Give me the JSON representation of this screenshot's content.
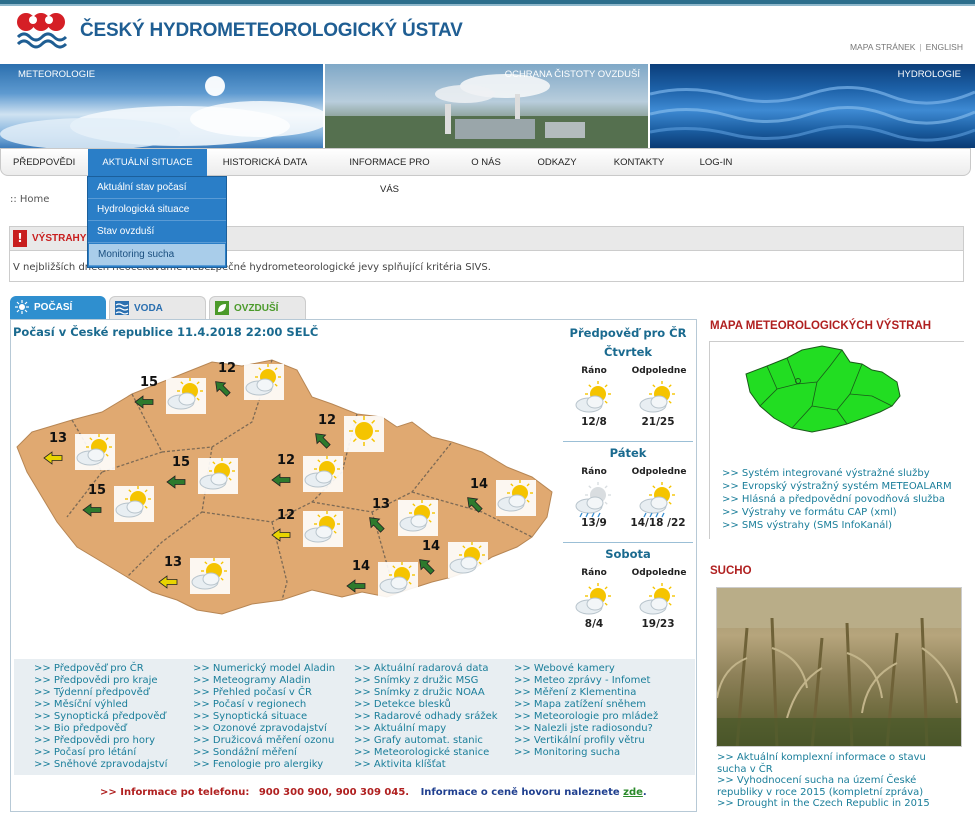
{
  "header": {
    "title": "ČESKÝ HYDROMETEOROLOGICKÝ ÚSTAV",
    "sitemap_link": "MAPA STRÁNEK",
    "separator": "|",
    "english_link": "ENGLISH"
  },
  "banner": {
    "meteo": "METEOROLOGIE",
    "air": "OCHRANA ČISTOTY OVZDUŠÍ",
    "hydro": "HYDROLOGIE"
  },
  "nav": {
    "items": [
      "PŘEDPOVĚDI",
      "AKTUÁLNÍ SITUACE",
      "HISTORICKÁ DATA",
      "INFORMACE PRO VÁS",
      "O NÁS",
      "ODKAZY",
      "KONTAKTY",
      "LOG-IN"
    ],
    "active": "AKTUÁLNÍ SITUACE",
    "dropdown": [
      "Aktuální stav počasí",
      "Hydrologická situace",
      "Stav ovzduší",
      "Monitoring sucha"
    ],
    "dropdown_highlighted": "Monitoring sucha"
  },
  "breadcrumb": ":: Home",
  "warnings": {
    "icon": "!",
    "title": "VÝSTRAHY",
    "text": "V nejbližších dnech neočekáváme nebezpečné hydrometeorologické jevy splňující kritéria SIVS."
  },
  "tabs": [
    {
      "label": "POČASÍ",
      "icon": "sun-icon",
      "active": true
    },
    {
      "label": "VODA",
      "icon": "water-waves-icon",
      "active": false
    },
    {
      "label": "OVZDUŠÍ",
      "icon": "leaf-icon",
      "active": false
    }
  ],
  "weather": {
    "title": "Počasí v České republice 11.4.2018 22:00 SELČ",
    "map_stations": [
      {
        "temp": "15",
        "wind": "W",
        "wind_color": "#2d7a2d",
        "icon": "sun-cloud-icon"
      },
      {
        "temp": "12",
        "wind": "NW",
        "wind_color": "#2d7a2d",
        "icon": "sun-cloud-icon"
      },
      {
        "temp": "12",
        "wind": "NW",
        "wind_color": "#2d7a2d",
        "icon": "sun-icon"
      },
      {
        "temp": "13",
        "wind": "W",
        "wind_color": "#e8d400",
        "icon": "sun-cloud-icon"
      },
      {
        "temp": "15",
        "wind": "W",
        "wind_color": "#2d7a2d",
        "icon": "sun-cloud-icon"
      },
      {
        "temp": "12",
        "wind": "W",
        "wind_color": "#2d7a2d",
        "icon": "sun-cloud-icon"
      },
      {
        "temp": "15",
        "wind": "W",
        "wind_color": "#2d7a2d",
        "icon": "sun-cloud-icon"
      },
      {
        "temp": "14",
        "wind": "NW",
        "wind_color": "#2d7a2d",
        "icon": "sun-cloud-icon"
      },
      {
        "temp": "13",
        "wind": "NW",
        "wind_color": "#2d7a2d",
        "icon": "sun-cloud-icon"
      },
      {
        "temp": "12",
        "wind": "W",
        "wind_color": "#e8d400",
        "icon": "sun-cloud-icon"
      },
      {
        "temp": "14",
        "wind": "NW",
        "wind_color": "#2d7a2d",
        "icon": "sun-cloud-icon"
      },
      {
        "temp": "13",
        "wind": "W",
        "wind_color": "#e8d400",
        "icon": "sun-cloud-icon"
      },
      {
        "temp": "14",
        "wind": "W",
        "wind_color": "#2d7a2d",
        "icon": "sun-cloud-icon"
      }
    ]
  },
  "forecast": {
    "title": "Předpověď pro ČR",
    "morning_label": "Ráno",
    "afternoon_label": "Odpoledne",
    "days": [
      {
        "name": "Čtvrtek",
        "morning_temp": "12/8",
        "afternoon_temp": "21/25",
        "morning_icon": "sun-cloud-icon",
        "afternoon_icon": "sun-cloud-icon"
      },
      {
        "name": "Pátek",
        "morning_temp": "13/9",
        "afternoon_temp": "14/18 /22",
        "morning_icon": "rain-cloud-icon",
        "afternoon_icon": "rain-sun-cloud-icon"
      },
      {
        "name": "Sobota",
        "morning_temp": "8/4",
        "afternoon_temp": "19/23",
        "morning_icon": "sun-cloud-icon",
        "afternoon_icon": "sun-cloud-icon"
      }
    ]
  },
  "links": {
    "col1": [
      ">> Předpověď pro ČR",
      ">> Předpovědi pro kraje",
      ">> Týdenní předpověď",
      ">> Měsíční výhled",
      ">> Synoptická předpověď",
      ">> Bio předpověď",
      ">> Předpovědi pro hory",
      ">> Počasí pro létání",
      ">> Sněhové zpravodajství"
    ],
    "col2": [
      ">> Numerický model Aladin",
      ">> Meteogramy Aladin",
      ">> Přehled počasí v ČR",
      ">> Počasí v regionech",
      ">> Synoptická situace",
      ">> Ozonové zpravodajství",
      ">> Družicová měření ozonu",
      ">> Sondážní měření",
      ">> Fenologie pro alergiky"
    ],
    "col3": [
      ">> Aktuální radarová data",
      ">> Snímky z družic MSG",
      ">> Snímky z družic NOAA",
      ">> Detekce blesků",
      ">> Radarové odhady srážek",
      ">> Aktuální mapy",
      ">> Grafy automat. stanic",
      ">> Meteorologické stanice",
      ">> Aktivita klíšťat"
    ],
    "col4": [
      ">> Webové kamery",
      ">> Meteo zprávy - Infomet",
      ">> Měření z Klementina",
      ">> Mapa zatížení sněhem",
      ">> Meteorologie pro mládež",
      ">> Nalezli jste radiosondu?",
      ">> Vertikální profily větru",
      ">> Monitoring sucha"
    ]
  },
  "phone": {
    "prefix": ">>",
    "label": "Informace po telefonu:",
    "numbers": "900 300 900,   900 309 045.",
    "price_text": "Informace o ceně hovoru naleznete",
    "price_link": "zde",
    "end": "."
  },
  "right": {
    "warn_map_title": "MAPA METEOROLOGICKÝCH VÝSTRAH",
    "warn_map_color": "#22dd22",
    "warn_links": [
      ">> Systém integrované výstražné služby",
      ">> Evropský výstražný systém METEOALARM",
      ">> Hlásná a předpovědní povodňová služba",
      ">> Výstrahy ve formátu CAP (xml)",
      ">> SMS výstrahy (SMS InfoKanál)"
    ],
    "drought_title": "SUCHO",
    "drought_links": [
      ">> Aktuální komplexní informace o stavu sucha v ČR",
      ">> Vyhodnocení sucha na území České republiky v roce 2015 (kompletní zpráva)",
      ">> Drought in the Czech Republic in 2015"
    ]
  },
  "colors": {
    "brand_blue": "#1f5e93",
    "nav_active": "#2a7ec7",
    "link": "#1a7e9a",
    "warning_red": "#c81e1e"
  }
}
